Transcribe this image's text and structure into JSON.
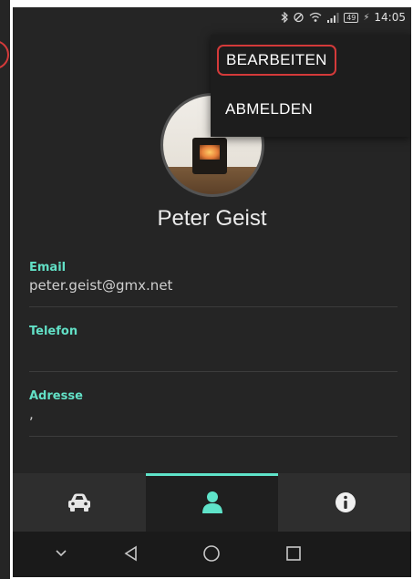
{
  "status_bar": {
    "battery": "49",
    "time": "14:05"
  },
  "profile": {
    "name": "Peter Geist"
  },
  "fields": [
    {
      "label": "Email",
      "value": "peter.geist@gmx.net"
    },
    {
      "label": "Telefon",
      "value": ""
    },
    {
      "label": "Adresse",
      "value": ","
    }
  ],
  "menu": {
    "items": [
      {
        "label": "BEARBEITEN"
      },
      {
        "label": "ABMELDEN"
      }
    ]
  },
  "bottom_nav": {
    "items": [
      {
        "icon": "car-icon",
        "active": false
      },
      {
        "icon": "person-icon",
        "active": true
      },
      {
        "icon": "info-icon",
        "active": false
      }
    ]
  },
  "system_nav": {
    "items": [
      "chevron-down-icon",
      "back-icon",
      "home-icon",
      "recents-icon"
    ]
  },
  "colors": {
    "accent": "#5fe3c9",
    "background": "#252525",
    "highlight_ring": "#d43a3a"
  }
}
